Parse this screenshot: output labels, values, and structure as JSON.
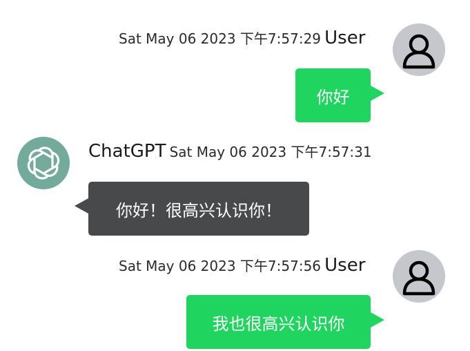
{
  "messages": [
    {
      "role": "user",
      "sender": "User",
      "timestamp": "Sat May 06 2023 下午7:57:29",
      "text": "你好",
      "avatar_icon": "user-silhouette-icon"
    },
    {
      "role": "assistant",
      "sender": "ChatGPT",
      "timestamp": "Sat May 06 2023 下午7:57:31",
      "text": "你好！很高兴认识你！",
      "avatar_icon": "chatgpt-logo-icon"
    },
    {
      "role": "user",
      "sender": "User",
      "timestamp": "Sat May 06 2023 下午7:57:56",
      "text": "我也很高兴认识你",
      "avatar_icon": "user-silhouette-icon"
    }
  ],
  "colors": {
    "user_bubble": "#1fd55f",
    "assistant_bubble": "#48494b",
    "user_avatar_bg": "#c5c7cc",
    "assistant_avatar_bg": "#74aa9c",
    "bubble_text": "#ffffff"
  }
}
